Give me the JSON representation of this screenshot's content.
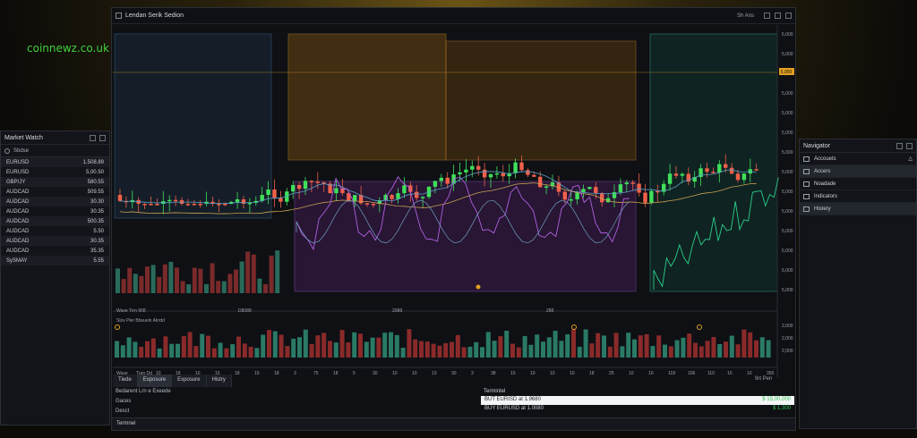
{
  "watermark": "coinnewz.co.uk",
  "window": {
    "title": "Lendan Serik Sedion",
    "right_label": "Sh Ans"
  },
  "chart": {
    "price_ticks": [
      "5,000",
      "5,000",
      "5,000",
      "5,000",
      "5,000",
      "5,000",
      "5,000",
      "5,000",
      "5,000",
      "5,000",
      "5,000",
      "5,000",
      "5,000",
      "5,000"
    ],
    "current_price": "5,000",
    "volume_label": "Wase Trrn 908",
    "volume_labels_mid": [
      "D8088",
      "2088",
      "288"
    ],
    "indicator_label": "Slov Pler Bbsueln Alrrdd",
    "indicator_ticks": [
      "2,000",
      "2,000",
      "2,000"
    ],
    "time_ticks": [
      "Wase",
      "Tran Dd",
      "10",
      "18",
      "10",
      "15",
      "18",
      "10",
      "18",
      "3",
      "75",
      "18",
      "5",
      "30",
      "10",
      "10",
      "13",
      "30",
      "3",
      "38",
      "10",
      "10",
      "10",
      "10",
      "18",
      "25",
      "10",
      "10",
      "118",
      "106",
      "110",
      "10",
      "10",
      "350"
    ]
  },
  "tabs": [
    "Tiede",
    "Exposure",
    "Exposure",
    "Histry"
  ],
  "bottom_left": [
    "Bedarent Lrn e Exeede",
    "Gaces",
    "Desct"
  ],
  "terminal": {
    "title": "Termintel",
    "rows": [
      {
        "text": "BUT EURISD at 1.9680",
        "value": "$ 15,00.000",
        "highlight": true
      },
      {
        "text": "BUY EURUSD at 1.0080",
        "value": "$ 1,300",
        "highlight": false
      }
    ],
    "label": "Termnel",
    "right_label": "9rt Pen"
  },
  "market_watch": {
    "title": "Market Watch",
    "search_label": "Sbdse",
    "rows": [
      {
        "symbol": "EURUSD",
        "price": "1.508.89"
      },
      {
        "symbol": "EURUSD",
        "price": "5,00.50"
      },
      {
        "symbol": "GBP/JY",
        "price": "580.55"
      },
      {
        "symbol": "AUDCAD",
        "price": "509.55"
      },
      {
        "symbol": "AUDCAD",
        "price": "30.30"
      },
      {
        "symbol": "AUDCAD",
        "price": "30.35"
      },
      {
        "symbol": "AUDCAD",
        "price": "500.35"
      },
      {
        "symbol": "AUDCAD",
        "price": "5.50"
      },
      {
        "symbol": "AUDCAD",
        "price": "30.35"
      },
      {
        "symbol": "AUDCAD",
        "price": "35.35"
      },
      {
        "symbol": "SySMAY",
        "price": "5.55"
      }
    ]
  },
  "navigator": {
    "title": "Navigator",
    "items": [
      {
        "label": "Accouets",
        "selected": false
      },
      {
        "label": "Accers",
        "selected": true
      },
      {
        "label": "Noadade",
        "selected": false
      },
      {
        "label": "Indicators",
        "selected": false
      },
      {
        "label": "Histery",
        "selected": true
      }
    ]
  },
  "colors": {
    "bull": "#3fe05a",
    "bear": "#f0604a",
    "accent": "#e0a020",
    "panel": "#121419"
  }
}
